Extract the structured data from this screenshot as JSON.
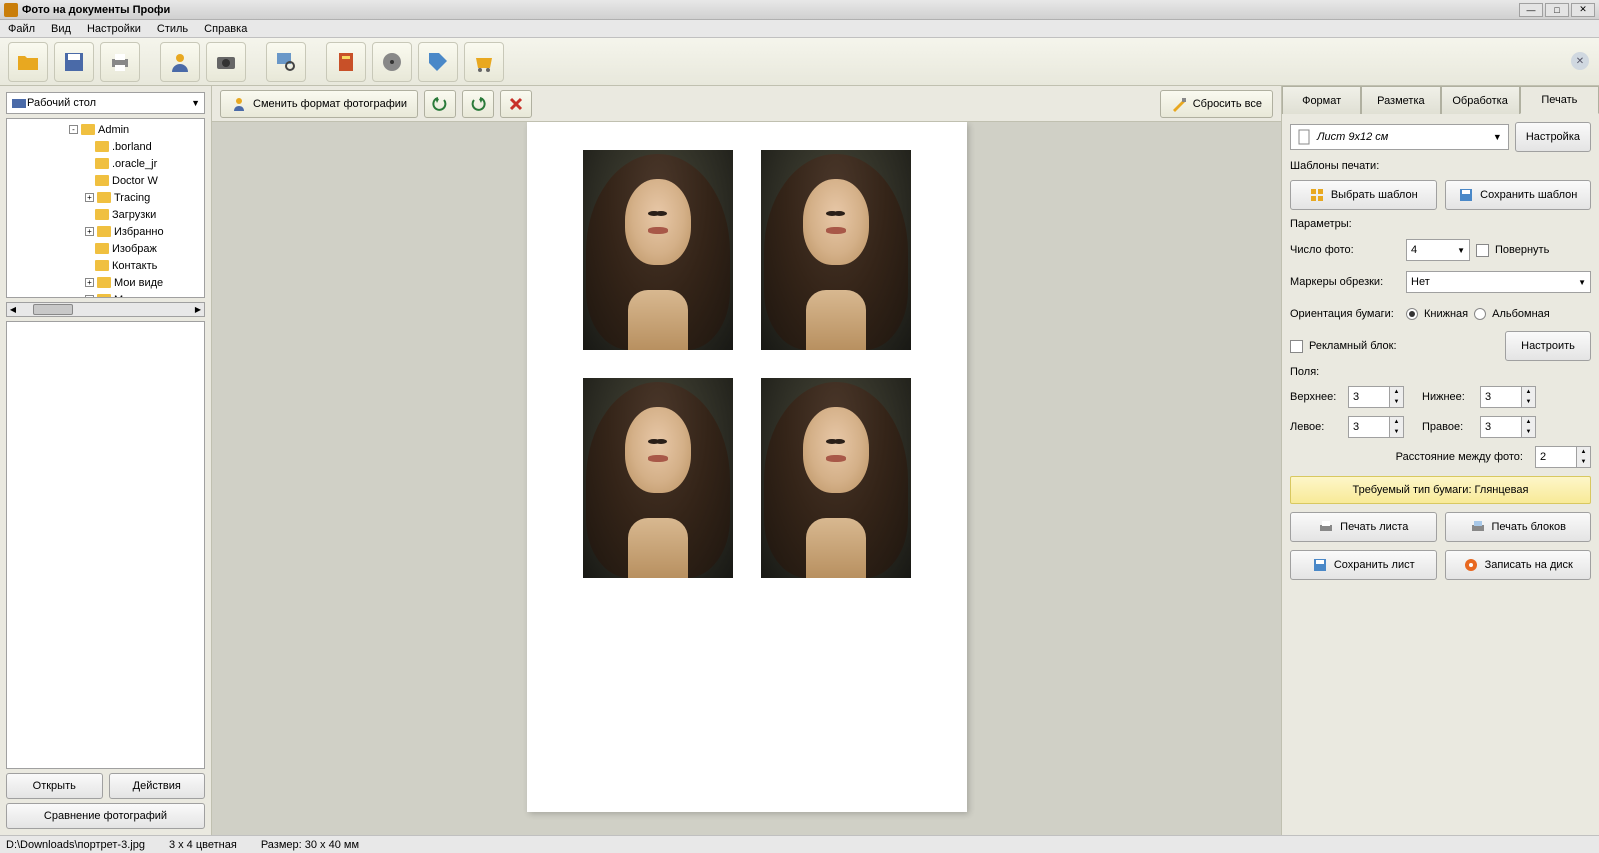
{
  "title": "Фото на документы Профи",
  "menu": [
    "Файл",
    "Вид",
    "Настройки",
    "Стиль",
    "Справка"
  ],
  "left": {
    "combo": "Рабочий стол",
    "tree": [
      {
        "indent": 60,
        "exp": "-",
        "label": "Admin"
      },
      {
        "indent": 86,
        "exp": "",
        "label": ".borland"
      },
      {
        "indent": 86,
        "exp": "",
        "label": ".oracle_jr"
      },
      {
        "indent": 86,
        "exp": "",
        "label": "Doctor W"
      },
      {
        "indent": 76,
        "exp": "+",
        "label": "Tracing"
      },
      {
        "indent": 86,
        "exp": "",
        "label": "Загрузки"
      },
      {
        "indent": 76,
        "exp": "+",
        "label": "Избранно"
      },
      {
        "indent": 86,
        "exp": "",
        "label": "Изображ"
      },
      {
        "indent": 86,
        "exp": "",
        "label": "Контакть"
      },
      {
        "indent": 76,
        "exp": "+",
        "label": "Мои виде"
      },
      {
        "indent": 76,
        "exp": "+",
        "label": "Мои доку"
      }
    ],
    "open": "Открыть",
    "actions": "Действия",
    "compare": "Сравнение фотографий"
  },
  "centerbar": {
    "change": "Сменить формат фотографии",
    "reset": "Сбросить все"
  },
  "tabs": [
    "Формат",
    "Разметка",
    "Обработка",
    "Печать"
  ],
  "right": {
    "sheet": "Лист 9x12 см",
    "settings": "Настройка",
    "templates_label": "Шаблоны печати:",
    "choose_tpl": "Выбрать шаблон",
    "save_tpl": "Сохранить шаблон",
    "params_label": "Параметры:",
    "count_label": "Число фото:",
    "count": "4",
    "rotate": "Повернуть",
    "markers_label": "Маркеры обрезки:",
    "markers": "Нет",
    "orient_label": "Ориентация бумаги:",
    "portrait": "Книжная",
    "landscape": "Альбомная",
    "adblock": "Рекламный блок:",
    "configure": "Настроить",
    "margins_label": "Поля:",
    "top": "Верхнее:",
    "top_v": "3",
    "bottom": "Нижнее:",
    "bottom_v": "3",
    "leftm": "Левое:",
    "left_v": "3",
    "rightm": "Правое:",
    "right_v": "3",
    "gap": "Расстояние между фото:",
    "gap_v": "2",
    "paper": "Требуемый тип бумаги: Глянцевая",
    "print_sheet": "Печать листа",
    "print_blocks": "Печать блоков",
    "save_sheet": "Сохранить лист",
    "burn": "Записать на диск"
  },
  "status": {
    "path": "D:\\Downloads\\портрет-3.jpg",
    "color": "3 x 4 цветная",
    "size": "Размер: 30 x 40 мм"
  }
}
